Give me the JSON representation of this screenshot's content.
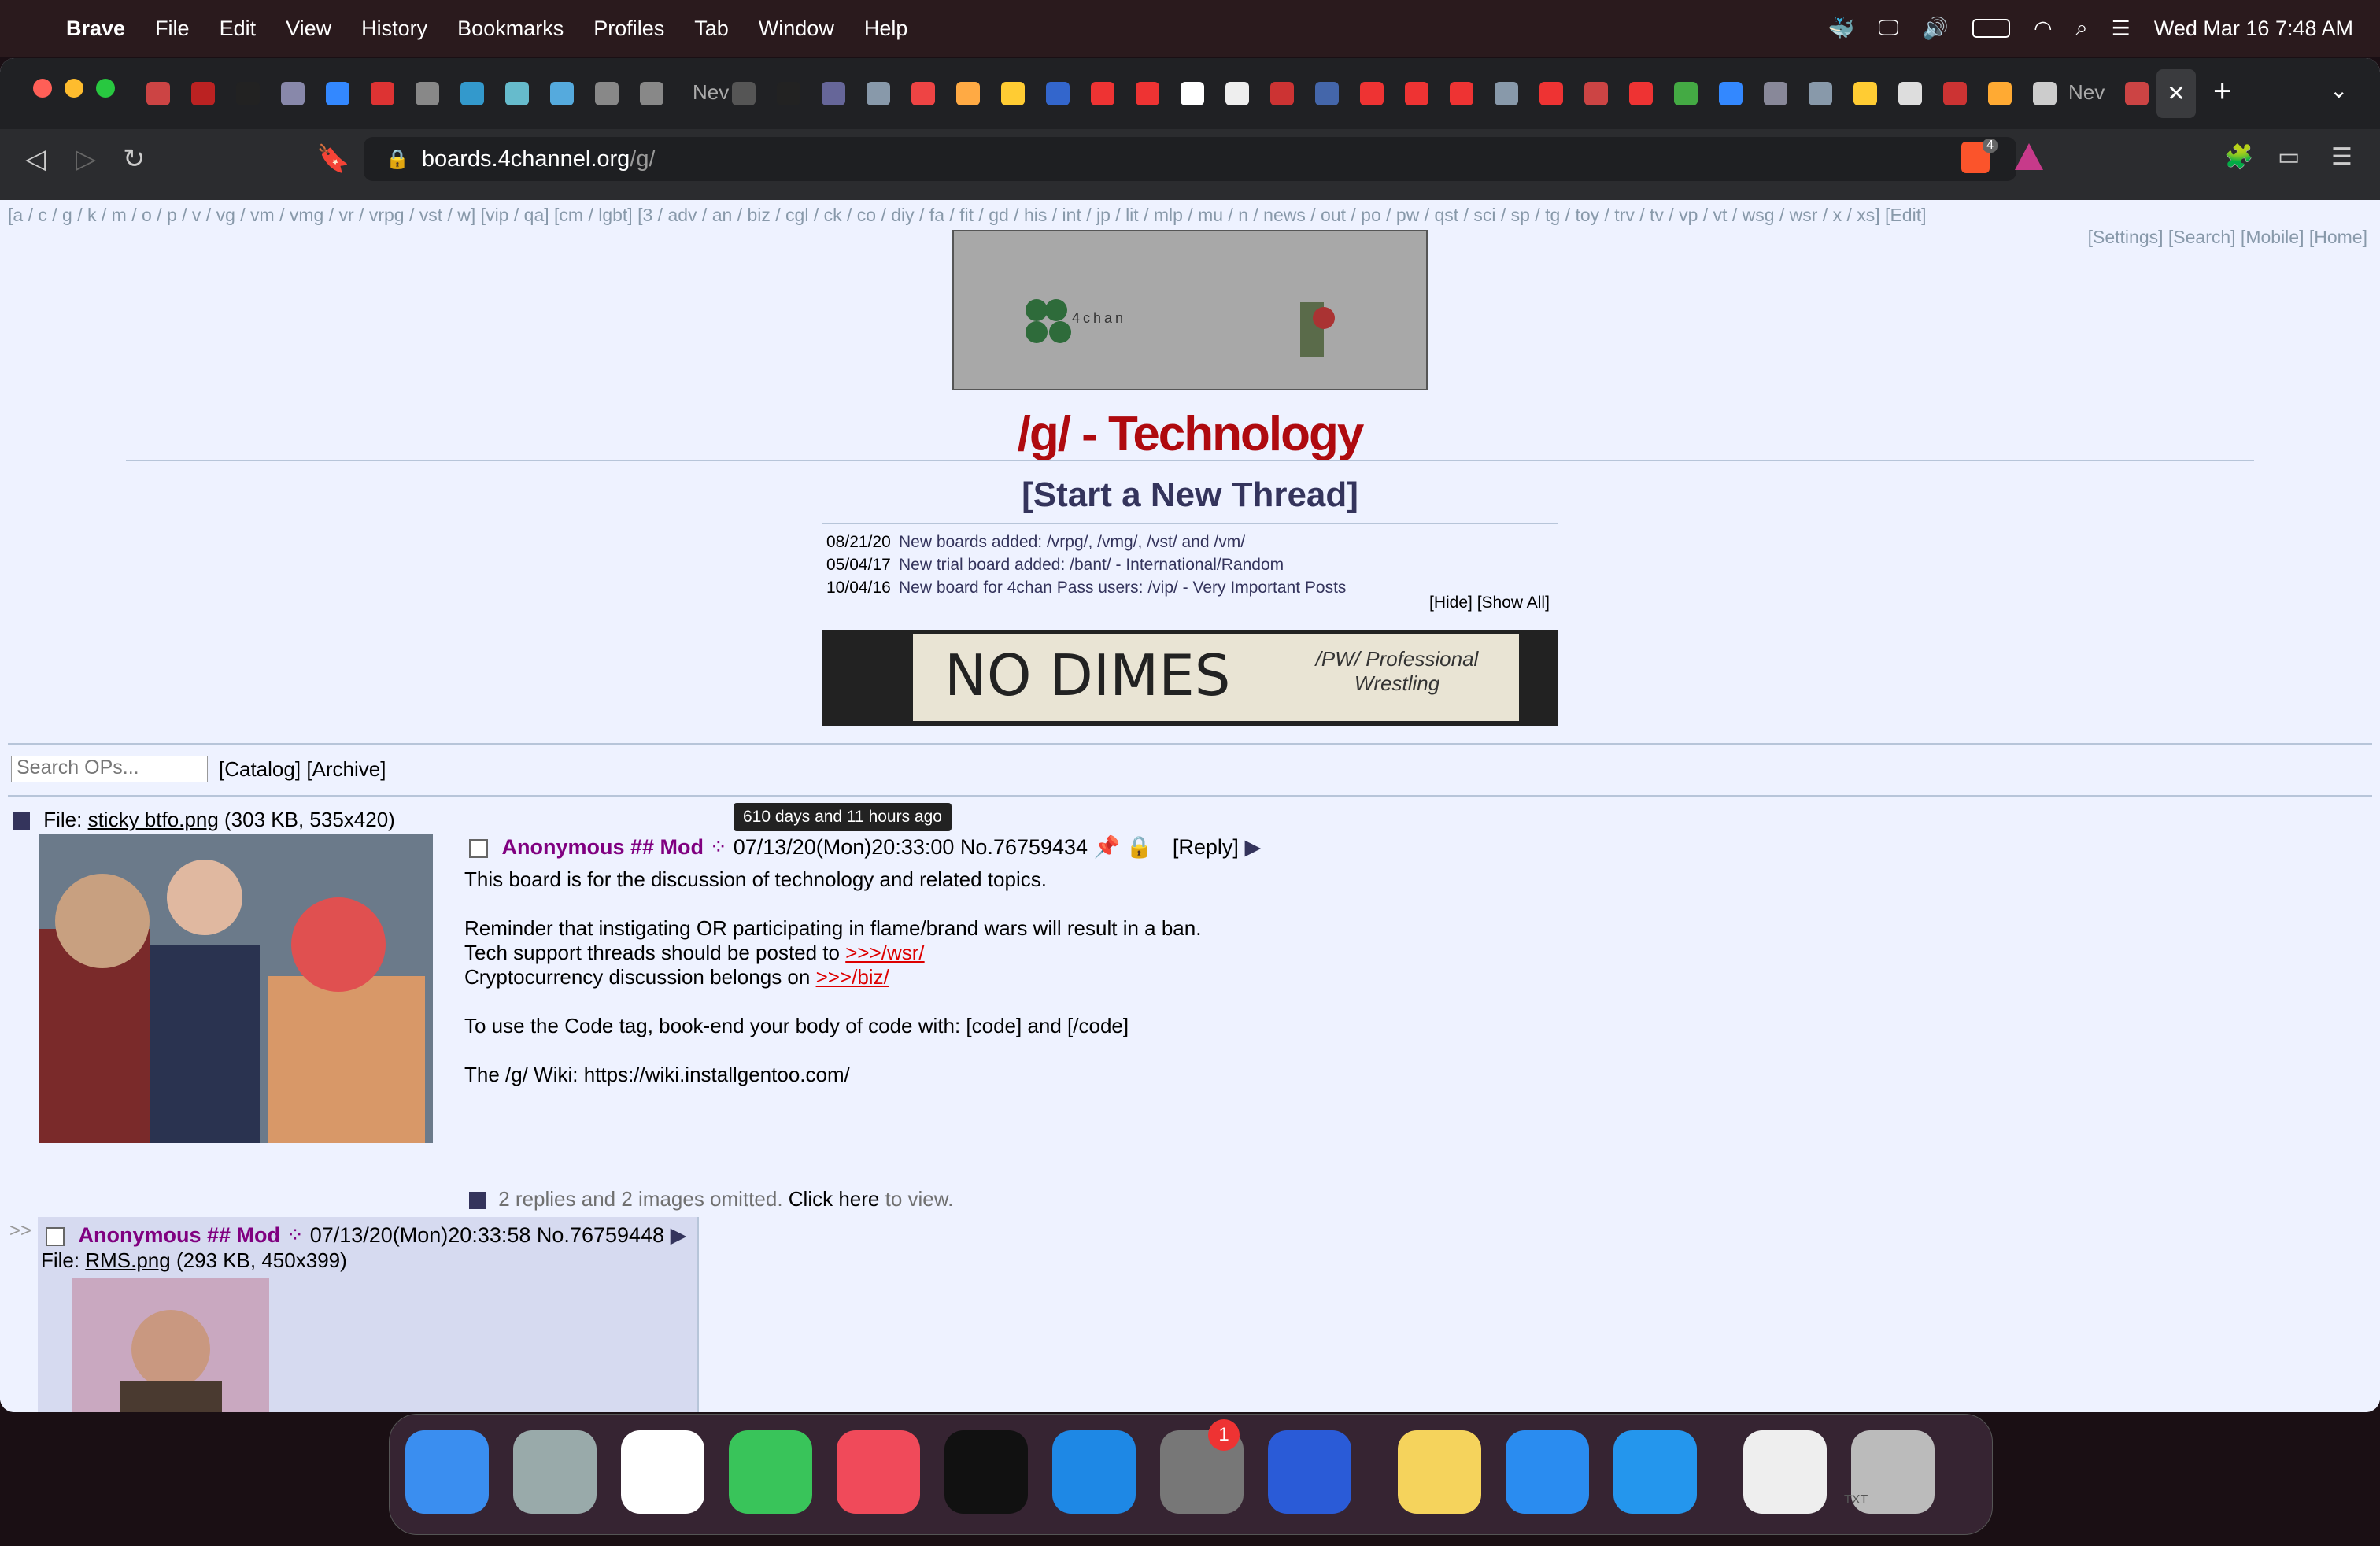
{
  "menubar": {
    "app_name": "Brave",
    "items": [
      "File",
      "Edit",
      "View",
      "History",
      "Bookmarks",
      "Profiles",
      "Tab",
      "Window",
      "Help"
    ],
    "clock": "Wed Mar 16  7:48 AM"
  },
  "browser": {
    "url_host": "boards.4channel.org",
    "url_path": "/g/",
    "tab_labels": [
      "Nev",
      "Nev"
    ],
    "shields_count": "4"
  },
  "page": {
    "boardlist": "[a / c / g / k / m / o / p / v / vg / vm / vmg / vr / vrpg / vst / w] [vip / qa] [cm / lgbt] [3 / adv / an / biz / cgl / ck / co / diy / fa / fit / gd / his / int / jp / lit / mlp / mu / n / news / out / po / pw / qst / sci / sp / tg / toy / trv / tv / vp / vt / wsg / wsr / x / xs] [Edit]",
    "boardlist_right": "[Settings] [Search] [Mobile] [Home]",
    "banner_text": "4chan",
    "board_title": "/g/ - Technology",
    "start_thread": "[Start a New Thread]",
    "news": [
      {
        "date": "08/21/20",
        "text": "New boards added: /vrpg/, /vmg/, /vst/ and /vm/"
      },
      {
        "date": "05/04/17",
        "text": "New trial board added: /bant/ - International/Random"
      },
      {
        "date": "10/04/16",
        "text": "New board for 4chan Pass users: /vip/ - Very Important Posts"
      }
    ],
    "news_ctrl": "[Hide] [Show All]",
    "ad_text": "NO DIMES",
    "ad_subtext": "/PW/ Professional Wrestling",
    "search_placeholder": "Search OPs...",
    "catalog": "[Catalog]",
    "archive": "[Archive]",
    "op": {
      "file_prefix": "File: ",
      "file_name": "sticky btfo.png",
      "file_meta": " (303 KB, 535x420)",
      "tooltip": "610 days and 11 hours ago",
      "name": "Anonymous ## Mod",
      "datetime": "07/13/20(Mon)20:33:00",
      "no": "No.76759434",
      "reply": "[Reply]",
      "lines": [
        "This board is for the discussion of technology and related topics.",
        "Reminder that instigating OR participating in flame/brand wars will result in a ban.",
        "Tech support threads should be posted to ",
        ">>>/wsr/",
        "Cryptocurrency discussion belongs on ",
        ">>>/biz/",
        "To use the Code tag, book-end your body of code with: [code] and [/code]",
        "The /g/ Wiki: https://wiki.installgentoo.com/"
      ],
      "omitted": "2 replies and 2 images omitted. ",
      "click_here": "Click here",
      "to_view": " to view."
    },
    "reply": {
      "arrow": ">>",
      "name": "Anonymous ## Mod",
      "datetime": "07/13/20(Mon)20:33:58",
      "no": "No.76759448",
      "file_prefix": "File: ",
      "file_name": "RMS.png",
      "file_meta": " (293 KB, 450x399)"
    }
  },
  "dock": {
    "apps": [
      "finder-icon",
      "launchpad-icon",
      "brave-icon",
      "facetime-icon",
      "music-icon",
      "terminal-icon",
      "vscode-icon",
      "system-preferences-icon",
      "arc-icon",
      "notes-icon",
      "safari-icon",
      "docker-icon",
      "txt-file-icon",
      "trash-icon"
    ],
    "badge": "1",
    "txt_label": "TXT"
  }
}
